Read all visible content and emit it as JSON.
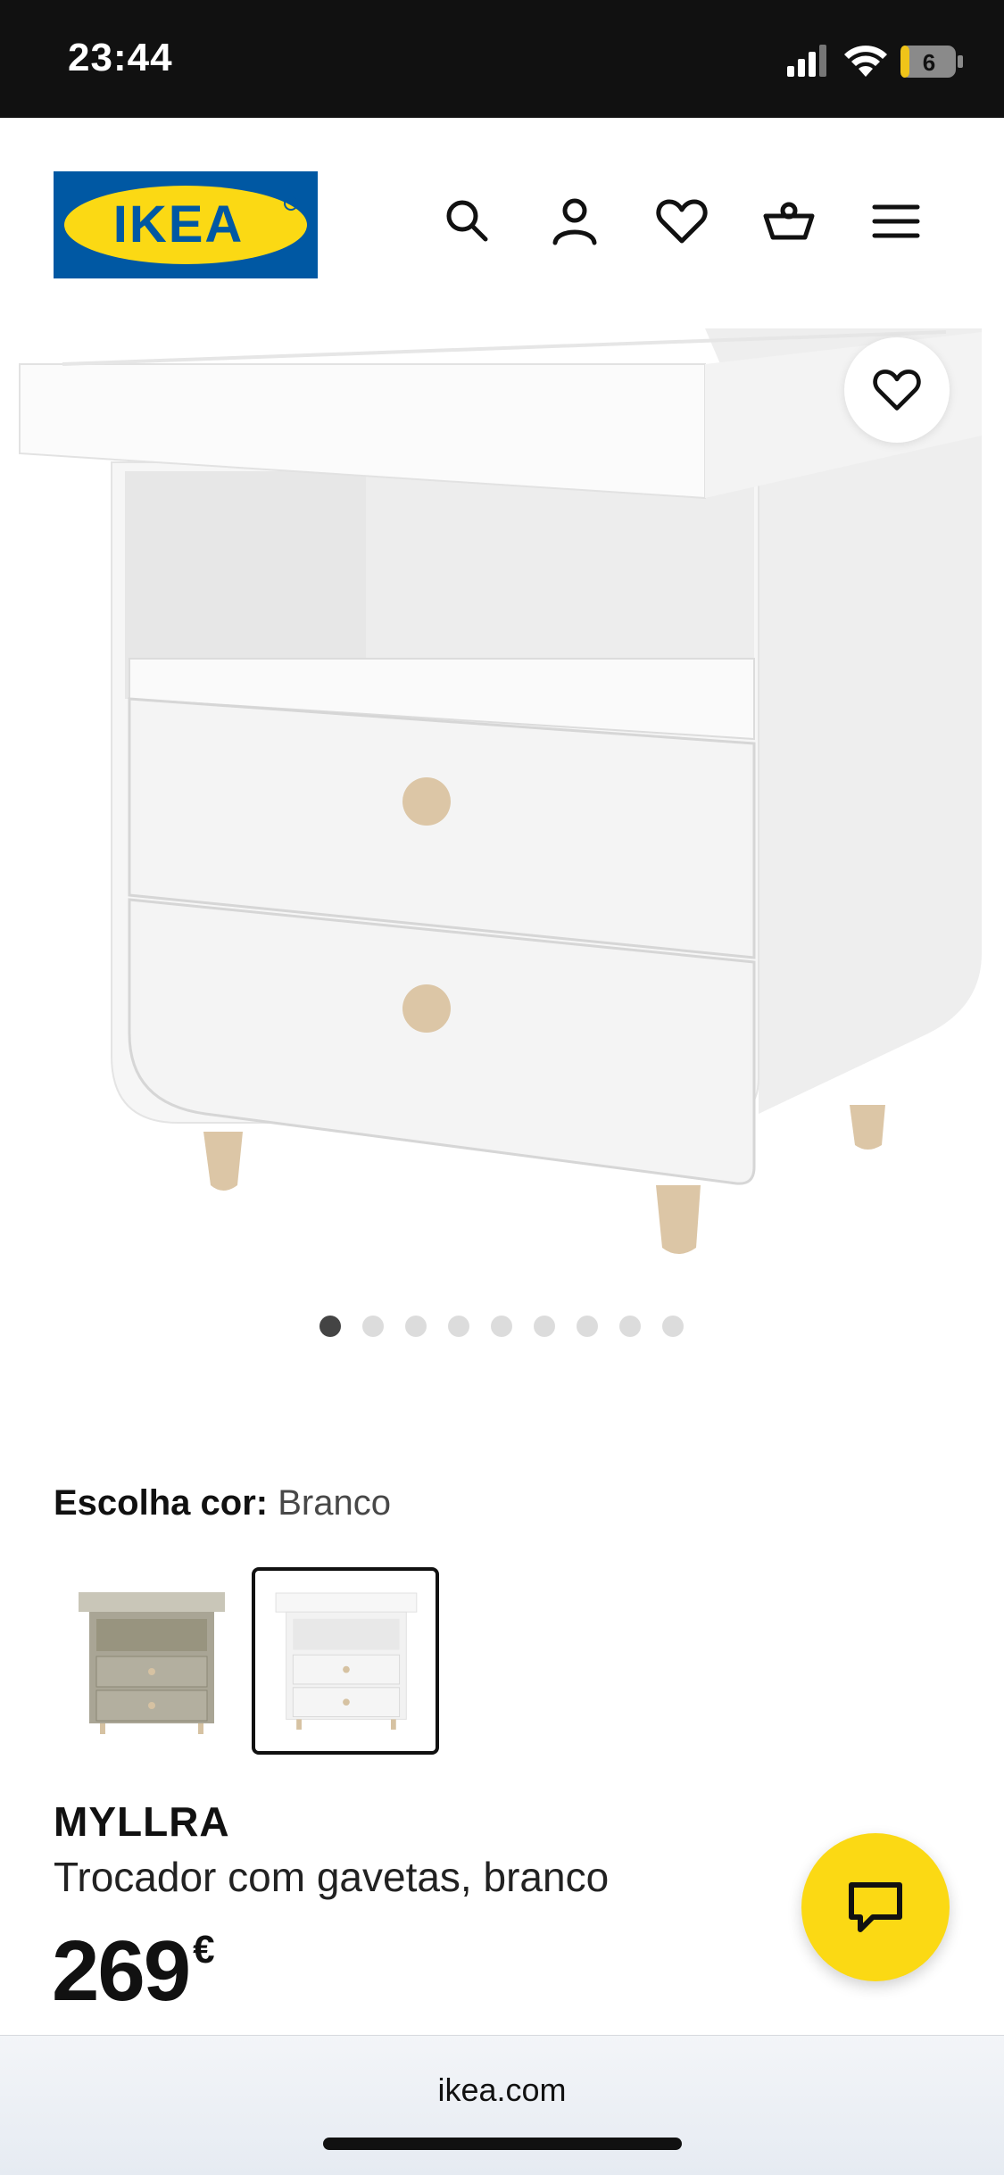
{
  "status_bar": {
    "time": "23:44",
    "battery": "6"
  },
  "header": {
    "logo_text": "IKEA",
    "brand_colors": {
      "blue": "#0058A3",
      "yellow": "#FBD914"
    },
    "icons": [
      "search-icon",
      "account-icon",
      "heart-icon",
      "basket-icon",
      "menu-icon"
    ]
  },
  "carousel": {
    "total": 9,
    "active_index": 0
  },
  "color_choice": {
    "label": "Escolha cor:",
    "value": "Branco",
    "options": [
      {
        "name": "beige",
        "color": "#a9a595",
        "selected": false
      },
      {
        "name": "white",
        "color": "#f3f3f3",
        "selected": true
      }
    ]
  },
  "product": {
    "name": "MYLLRA",
    "description": "Trocador com gavetas, branco",
    "price": "269",
    "currency": "€"
  },
  "browser": {
    "url": "ikea.com"
  }
}
